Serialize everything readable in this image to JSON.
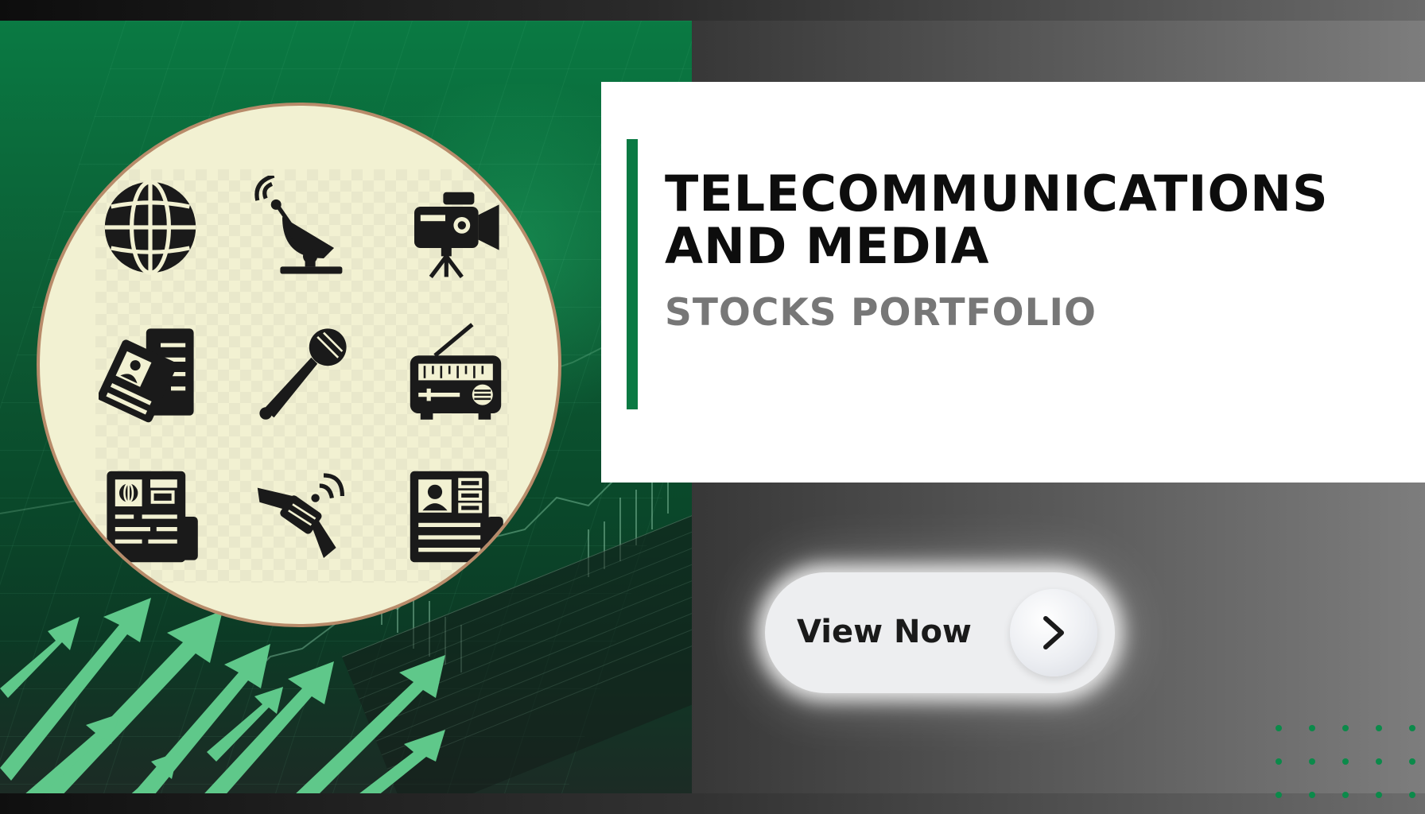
{
  "title": {
    "line1": "TELECOMMUNICATIONS",
    "line2": "AND MEDIA"
  },
  "subtitle": "STOCKS PORTFOLIO",
  "cta": {
    "label": "View Now",
    "icon": "chevron-right-icon"
  },
  "icons": [
    "globe-icon",
    "satellite-dish-icon",
    "video-camera-icon",
    "newspaper-icon",
    "microphone-icon",
    "radio-icon",
    "news-page-icon",
    "satellite-icon",
    "profile-article-icon"
  ],
  "colors": {
    "accent_green": "#0a7a43",
    "arrow_green": "#5fc88a",
    "badge_fill": "#f2f1d2",
    "badge_border": "#b88b6a",
    "title_text": "#0d0d0d",
    "subtitle_text": "#777777"
  }
}
